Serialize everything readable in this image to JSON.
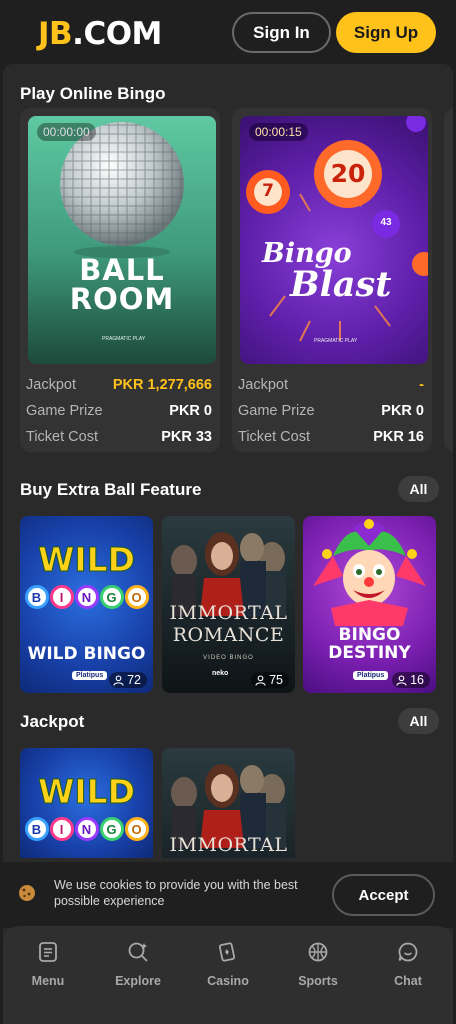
{
  "header": {
    "logo_jb": "JB",
    "logo_com": ".COM",
    "signin_label": "Sign In",
    "signup_label": "Sign Up"
  },
  "play_online_bingo": {
    "title": "Play Online Bingo",
    "cards": [
      {
        "timer": "00:00:00",
        "art_line1": "BALL",
        "art_line2": "ROOM",
        "studio": "PRAGMATIC PLAY",
        "jackpot_label": "Jackpot",
        "jackpot_value": "PKR 1,277,666",
        "prize_label": "Game Prize",
        "prize_value": "PKR 0",
        "ticket_label": "Ticket Cost",
        "ticket_value": "PKR 33"
      },
      {
        "timer": "00:00:15",
        "art_line1": "Bingo",
        "art_line2": "Blast",
        "ball_big": "20",
        "ball_small": "7",
        "ball_tiny": "43",
        "studio": "PRAGMATIC PLAY",
        "jackpot_label": "Jackpot",
        "jackpot_value": "-",
        "prize_label": "Game Prize",
        "prize_value": "PKR 0",
        "ticket_label": "Ticket Cost",
        "ticket_value": "PKR 16"
      }
    ]
  },
  "buy_extra_ball": {
    "title": "Buy Extra Ball Feature",
    "all_label": "All",
    "games": [
      {
        "name": "WILD BINGO",
        "art_word": "WILD",
        "letters": [
          "B",
          "I",
          "N",
          "G",
          "O"
        ],
        "provider": "Platipus",
        "players": "72"
      },
      {
        "name": "IMMORTAL ROMANCE",
        "art_line1": "IMMORTAL",
        "art_line2": "ROMANCE",
        "subtitle": "VIDEO BINGO",
        "provider": "neko",
        "players": "75"
      },
      {
        "name": "BINGO DESTINY",
        "art_line1": "BINGO",
        "art_line2": "DESTINY",
        "provider": "Platipus",
        "players": "16"
      }
    ]
  },
  "jackpot": {
    "title": "Jackpot",
    "all_label": "All",
    "games": [
      {
        "art_word": "WILD",
        "letters": [
          "B",
          "I",
          "N",
          "G",
          "O"
        ]
      },
      {
        "art_line1": "IMMORTAL"
      }
    ]
  },
  "cookie": {
    "text": "We use cookies to provide you with the best possible experience",
    "accept_label": "Accept"
  },
  "nav": {
    "items": [
      {
        "label": "Menu",
        "icon": "menu-icon"
      },
      {
        "label": "Explore",
        "icon": "explore-icon"
      },
      {
        "label": "Casino",
        "icon": "casino-icon"
      },
      {
        "label": "Sports",
        "icon": "sports-icon"
      },
      {
        "label": "Chat",
        "icon": "chat-icon"
      }
    ]
  },
  "colors": {
    "brand_yellow": "#ffc21a",
    "background": "#1f1f1f",
    "panel": "#2a2a2a"
  }
}
